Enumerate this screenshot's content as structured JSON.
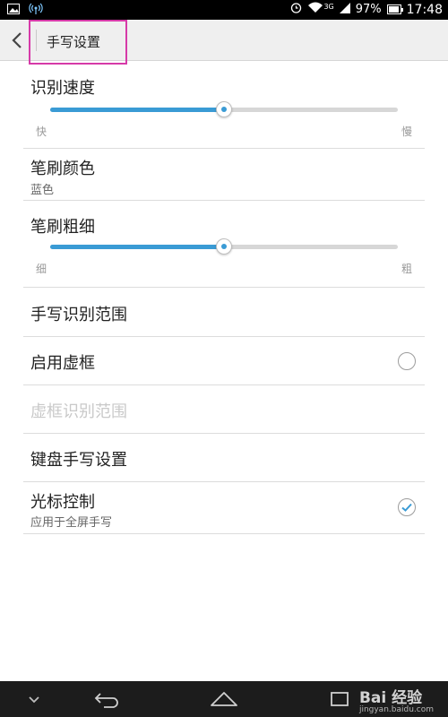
{
  "status_bar": {
    "battery_percent": "97%",
    "time": "17:48",
    "network_label": "3G"
  },
  "header": {
    "title": "手写设置"
  },
  "settings": {
    "recognition_speed": {
      "title": "识别速度",
      "min_label": "快",
      "max_label": "慢",
      "value": 0.5
    },
    "brush_color": {
      "title": "笔刷颜色",
      "value": "蓝色"
    },
    "brush_thickness": {
      "title": "笔刷粗细",
      "min_label": "细",
      "max_label": "粗",
      "value": 0.5
    },
    "recognition_range": {
      "title": "手写识别范围"
    },
    "enable_frame": {
      "title": "启用虚框",
      "checked": false
    },
    "frame_recognition_range": {
      "title": "虚框识别范围",
      "enabled": false
    },
    "keyboard_handwriting": {
      "title": "键盘手写设置"
    },
    "cursor_control": {
      "title": "光标控制",
      "subtitle": "应用于全屏手写",
      "checked": true
    }
  },
  "watermark": {
    "brand": "Bai 经验",
    "url": "jingyan.baidu.com"
  },
  "colors": {
    "accent": "#3a9bd5",
    "highlight_box": "#d63aa8"
  }
}
